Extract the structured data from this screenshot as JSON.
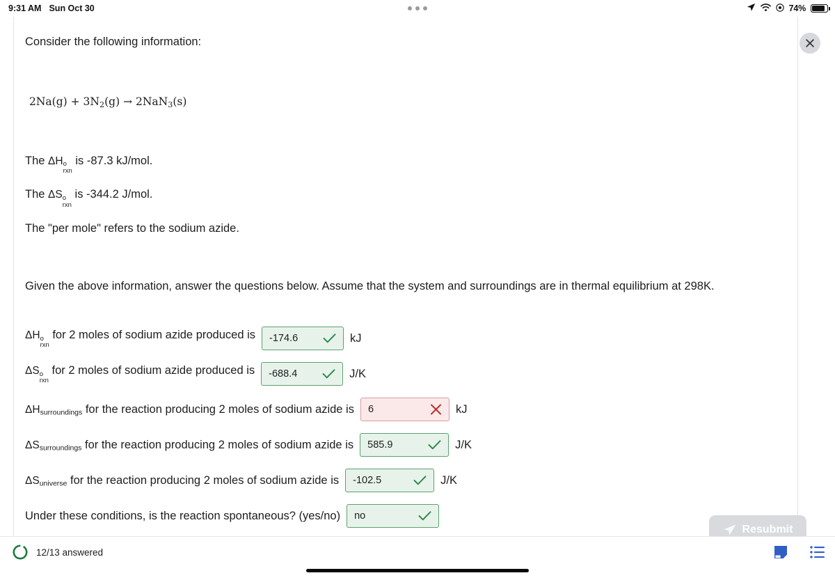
{
  "status_bar": {
    "time": "9:31 AM",
    "date": "Sun Oct 30",
    "battery_percent": "74%",
    "icons": [
      "location-arrow-icon",
      "wifi-icon",
      "focus-icon",
      "battery-icon"
    ],
    "multitask_indicator": "three-dots-icon"
  },
  "content": {
    "lead": "Consider the following information:",
    "equation": {
      "full": "2Na(g) + 3N2(g) → 2NaN3(s)",
      "lhs_a": "2Na(g)",
      "plus": "+",
      "lhs_b_pre": "3N",
      "lhs_b_sub": "2",
      "lhs_b_post": "(g)",
      "arrow": "→",
      "rhs_pre": "2NaN",
      "rhs_sub": "3",
      "rhs_post": "(s)"
    },
    "facts": [
      {
        "pre": "The ",
        "sym_base": "ΔH",
        "sym_sup": "o",
        "sym_sub": "rxn",
        "post": " is -87.3 kJ/mol."
      },
      {
        "pre": "The ",
        "sym_base": "ΔS",
        "sym_sup": "o",
        "sym_sub": "rxn",
        "post": " is -344.2 J/mol."
      }
    ],
    "per_mole_note": "The \"per mole\" refers to the sodium azide.",
    "given": "Given the above information, answer the questions below. Assume that the system and surroundings are in thermal equilibrium at 298K."
  },
  "questions": [
    {
      "sym_base": "ΔH",
      "sym_sup": "o",
      "sym_sub": "rxn",
      "sym_plain": "",
      "text": " for 2 moles of sodium azide produced is",
      "value": "-174.6",
      "unit": "kJ",
      "state": "correct",
      "mark": "check-icon",
      "width": "w118"
    },
    {
      "sym_base": "ΔS",
      "sym_sup": "o",
      "sym_sub": "rxn",
      "sym_plain": "",
      "text": " for 2 moles of sodium azide produced is",
      "value": "-688.4",
      "unit": "J/K",
      "state": "correct",
      "mark": "check-icon",
      "width": "w118"
    },
    {
      "sym_base": "ΔH",
      "sym_sup": "",
      "sym_sub": "",
      "sym_plain": "surroundings",
      "text": " for the reaction producing 2 moles of sodium azide is",
      "value": "6",
      "unit": "kJ",
      "state": "incorrect",
      "mark": "cross-icon",
      "width": "w128"
    },
    {
      "sym_base": "ΔS",
      "sym_sup": "",
      "sym_sub": "",
      "sym_plain": "surroundings",
      "text": " for the reaction producing 2 moles of sodium azide is",
      "value": "585.9",
      "unit": "J/K",
      "state": "correct",
      "mark": "check-icon",
      "width": "w128"
    },
    {
      "sym_base": "ΔS",
      "sym_sup": "",
      "sym_sub": "",
      "sym_plain": "universe",
      "text": " for the reaction producing 2 moles of sodium azide is",
      "value": "-102.5",
      "unit": "J/K",
      "state": "correct",
      "mark": "check-icon",
      "width": "w128"
    },
    {
      "sym_base": "",
      "sym_sup": "",
      "sym_sub": "",
      "sym_plain": "",
      "text": "Under these conditions, is the reaction spontaneous? (yes/no)",
      "value": "no",
      "unit": "",
      "state": "correct",
      "mark": "check-icon",
      "width": "w133"
    }
  ],
  "close_button": {
    "name": "close-icon",
    "label": "×"
  },
  "resubmit": {
    "label": "Resubmit",
    "icon": "paper-plane-icon"
  },
  "bottom_bar": {
    "progress_label": "12/13 answered",
    "progress_ring": "progress-ring-icon",
    "icons": [
      "note-icon",
      "list-icon"
    ]
  },
  "colors": {
    "correct_bg": "#e7f3ea",
    "correct_border": "#5aa06e",
    "correct_mark": "#2e8b4f",
    "incorrect_bg": "#fbe9ea",
    "incorrect_border": "#d79ba1",
    "incorrect_mark": "#c0392b",
    "accent_blue": "#2f5fc4",
    "progress_green": "#1d7a3e"
  }
}
